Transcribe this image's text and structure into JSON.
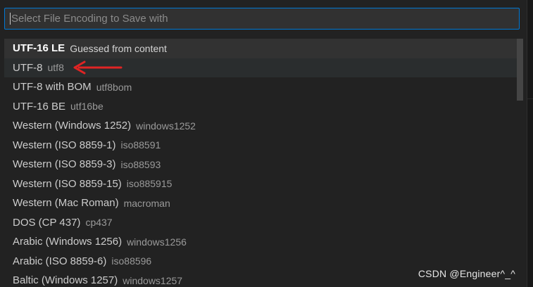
{
  "quick_pick": {
    "placeholder": "Select File Encoding to Save with",
    "value": ""
  },
  "items": [
    {
      "label": "UTF-16 LE",
      "description": "Guessed from content",
      "state": "focused"
    },
    {
      "label": "UTF-8",
      "description": "utf8",
      "state": "hovered"
    },
    {
      "label": "UTF-8 with BOM",
      "description": "utf8bom"
    },
    {
      "label": "UTF-16 BE",
      "description": "utf16be"
    },
    {
      "label": "Western (Windows 1252)",
      "description": "windows1252"
    },
    {
      "label": "Western (ISO 8859-1)",
      "description": "iso88591"
    },
    {
      "label": "Western (ISO 8859-3)",
      "description": "iso88593"
    },
    {
      "label": "Western (ISO 8859-15)",
      "description": "iso885915"
    },
    {
      "label": "Western (Mac Roman)",
      "description": "macroman"
    },
    {
      "label": "DOS (CP 437)",
      "description": "cp437"
    },
    {
      "label": "Arabic (Windows 1256)",
      "description": "windows1256"
    },
    {
      "label": "Arabic (ISO 8859-6)",
      "description": "iso88596"
    },
    {
      "label": "Baltic (Windows 1257)",
      "description": "windows1257"
    }
  ],
  "annotation": {
    "arrow_color": "#e02424",
    "points_to": "UTF-8"
  },
  "watermark": "CSDN @Engineer^_^",
  "colors": {
    "accent": "#0078d4",
    "background": "#222222",
    "focused_row": "#323232"
  }
}
